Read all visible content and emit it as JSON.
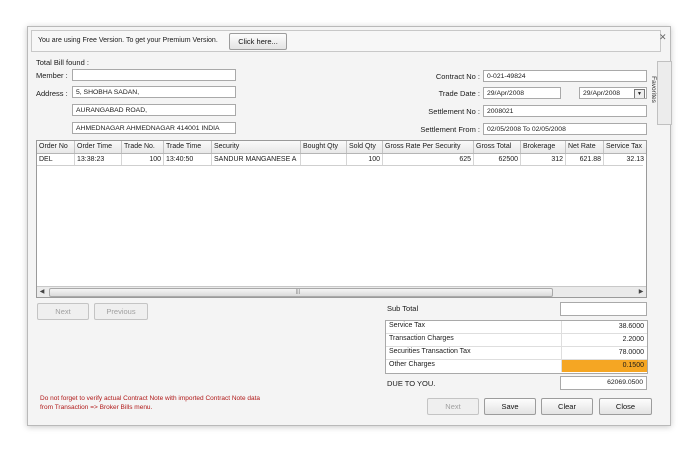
{
  "notice": {
    "text": "You are using Free Version. To get your Premium Version.",
    "button": "Click here..."
  },
  "side_tab": "Favorites",
  "header": {
    "total_bill": "Total Bill found :",
    "member_label": "Member :",
    "member_value": "",
    "address_label": "Address :",
    "address_lines": [
      "5, SHOBHA SADAN,",
      "AURANGABAD ROAD,",
      "AHMEDNAGAR AHMEDNAGAR 414001 INDIA"
    ],
    "contract_label": "Contract No :",
    "contract_value": "0-021-49824",
    "trade_date_label": "Trade Date :",
    "trade_date_value": "29/Apr/2008",
    "trade_date_select": "29/Apr/2008",
    "settlement_no_label": "Settlement No :",
    "settlement_no_value": "2008021",
    "settlement_from_label": "Settlement From :",
    "settlement_from_value": "02/05/2008 To 02/05/2008"
  },
  "grid": {
    "columns": [
      "Order No",
      "Order Time",
      "Trade No.",
      "Trade Time",
      "Security",
      "Bought Qty",
      "Sold Qty",
      "Gross Rate Per Security",
      "Gross Total",
      "Brokerage",
      "Net Rate",
      "Service Tax"
    ],
    "rows": [
      [
        "DEL",
        "13:38:23",
        "100",
        "13:40:50",
        "SANDUR MANGANESE A",
        "",
        "100",
        "625",
        "62500",
        "312",
        "621.88",
        "32.13"
      ]
    ]
  },
  "nav": {
    "next": "Next",
    "previous": "Previous"
  },
  "totals": {
    "sub_total_label": "Sub Total",
    "sub_total_value": "",
    "charges": [
      {
        "label": "Service Tax",
        "value": "38.6000"
      },
      {
        "label": "Transaction Charges",
        "value": "2.2000"
      },
      {
        "label": "Securities Transaction Tax",
        "value": "78.0000"
      },
      {
        "label": "Other Charges",
        "value": "0.1500"
      }
    ],
    "due_label": "DUE TO YOU.",
    "due_value": "62069.0500"
  },
  "note": "Do not forget to verify actual Contract Note with imported Contract Note data from Transaction => Broker Bills menu.",
  "buttons": {
    "next": "Next",
    "save": "Save",
    "clear": "Clear",
    "close": "Close"
  },
  "colors": {
    "highlight": "#f5a623",
    "note_text": "#b01818"
  }
}
